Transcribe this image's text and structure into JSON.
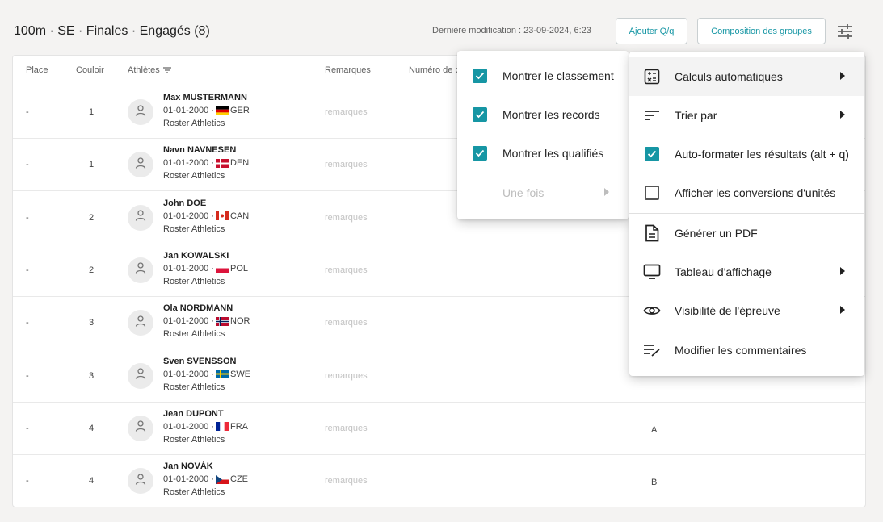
{
  "header": {
    "title": "100m · SE · Finales · Engagés (8)",
    "last_modified": "Dernière modification : 23-09-2024, 6:23",
    "add_button": "Ajouter Q/q",
    "groups_button": "Composition des groupes",
    "settings_icon": "tune-icon"
  },
  "table": {
    "columns": {
      "place": "Place",
      "lane": "Couloir",
      "athletes": "Athlètes",
      "remarks": "Remarques",
      "number": "Numéro de c"
    },
    "rows": [
      {
        "place": "-",
        "lane": "1",
        "name": "Max MUSTERMANN",
        "dob": "01-01-2000 ·",
        "country": "GER",
        "club": "Roster Athletics",
        "remarks": "remarques",
        "group": ""
      },
      {
        "place": "-",
        "lane": "1",
        "name": "Navn NAVNESEN",
        "dob": "01-01-2000 ·",
        "country": "DEN",
        "club": "Roster Athletics",
        "remarks": "remarques",
        "group": ""
      },
      {
        "place": "-",
        "lane": "2",
        "name": "John DOE",
        "dob": "01-01-2000 ·",
        "country": "CAN",
        "club": "Roster Athletics",
        "remarks": "remarques",
        "group": ""
      },
      {
        "place": "-",
        "lane": "2",
        "name": "Jan KOWALSKI",
        "dob": "01-01-2000 ·",
        "country": "POL",
        "club": "Roster Athletics",
        "remarks": "remarques",
        "group": ""
      },
      {
        "place": "-",
        "lane": "3",
        "name": "Ola NORDMANN",
        "dob": "01-01-2000 ·",
        "country": "NOR",
        "club": "Roster Athletics",
        "remarks": "remarques",
        "group": ""
      },
      {
        "place": "-",
        "lane": "3",
        "name": "Sven SVENSSON",
        "dob": "01-01-2000 ·",
        "country": "SWE",
        "club": "Roster Athletics",
        "remarks": "remarques",
        "group": ""
      },
      {
        "place": "-",
        "lane": "4",
        "name": "Jean DUPONT",
        "dob": "01-01-2000 ·",
        "country": "FRA",
        "club": "Roster Athletics",
        "remarks": "remarques",
        "group": "A"
      },
      {
        "place": "-",
        "lane": "4",
        "name": "Jan NOVÁK",
        "dob": "01-01-2000 ·",
        "country": "CZE",
        "club": "Roster Athletics",
        "remarks": "remarques",
        "group": "B"
      }
    ]
  },
  "submenu": {
    "items": [
      {
        "label": "Montrer le classement",
        "checked": true
      },
      {
        "label": "Montrer les records",
        "checked": true
      },
      {
        "label": "Montrer les qualifiés",
        "checked": true
      },
      {
        "label": "Une fois",
        "disabled": true
      }
    ]
  },
  "menu": {
    "items": [
      {
        "label": "Calculs automatiques",
        "icon": "calculator-icon"
      },
      {
        "label": "Trier par",
        "icon": "sort-icon"
      },
      {
        "label": "Auto-formater les résultats (alt + q)",
        "icon": "checkbox-checked-icon"
      },
      {
        "label": "Afficher les conversions d'unités",
        "icon": "checkbox-empty-icon"
      },
      {
        "label": "Générer un PDF",
        "icon": "document-icon"
      },
      {
        "label": "Tableau d'affichage",
        "icon": "monitor-icon"
      },
      {
        "label": "Visibilité de l'épreuve",
        "icon": "eye-icon"
      },
      {
        "label": "Modifier les commentaires",
        "icon": "edit-notes-icon"
      }
    ]
  },
  "colors": {
    "accent": "#1696a4",
    "background": "#f4f3f2"
  }
}
